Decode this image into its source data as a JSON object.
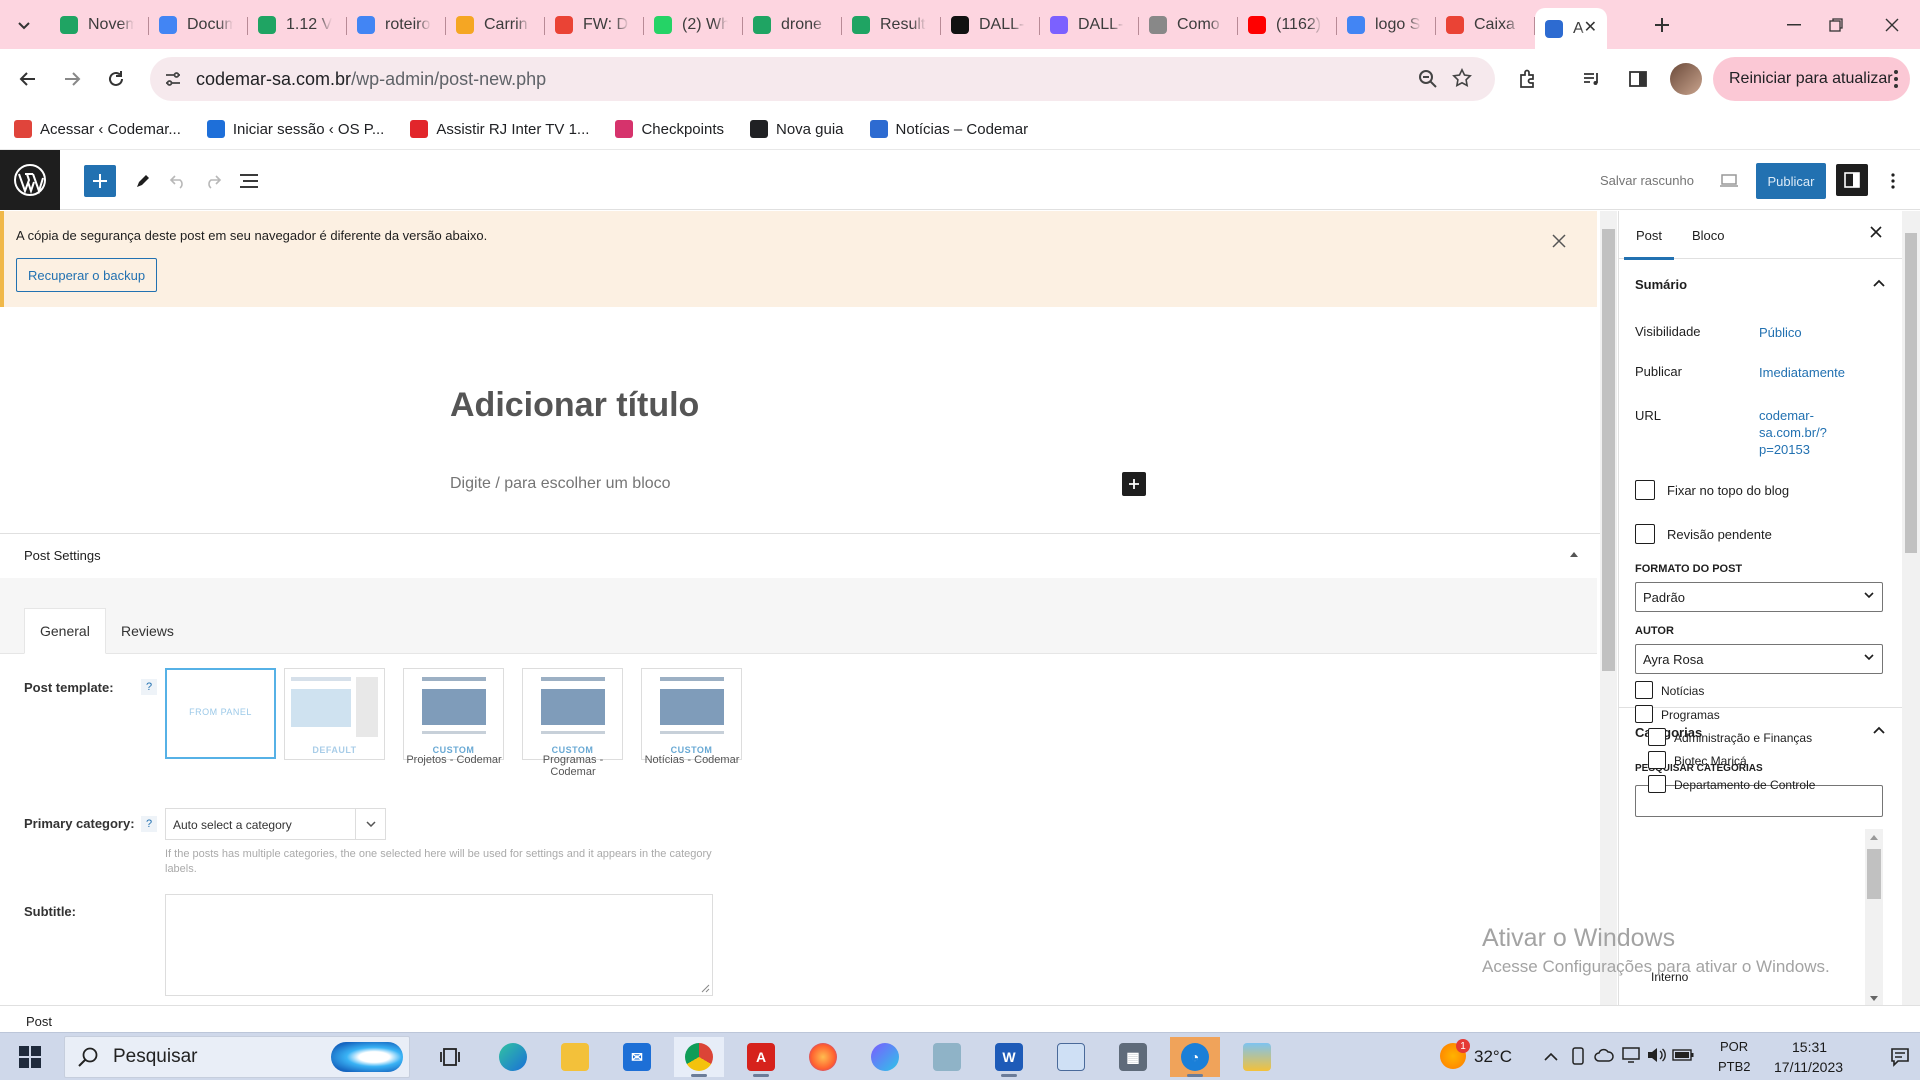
{
  "chrome": {
    "tabs": [
      {
        "title": "Novem",
        "icon": "google-drive-icon",
        "color": "#1fa463"
      },
      {
        "title": "Docum",
        "icon": "google-docs-icon",
        "color": "#4285f4"
      },
      {
        "title": "1.12 V",
        "icon": "google-drive-icon",
        "color": "#1fa463"
      },
      {
        "title": "roteiro",
        "icon": "google-docs-icon",
        "color": "#4285f4"
      },
      {
        "title": "Carrin",
        "icon": "shopping-icon",
        "color": "#f5a623"
      },
      {
        "title": "FW: D",
        "icon": "gmail-icon",
        "color": "#ea4335"
      },
      {
        "title": "(2) Wh",
        "icon": "whatsapp-icon",
        "color": "#25d366"
      },
      {
        "title": "drone",
        "icon": "google-drive-icon",
        "color": "#1fa463"
      },
      {
        "title": "Result",
        "icon": "google-drive-icon",
        "color": "#1fa463"
      },
      {
        "title": "DALL-E",
        "icon": "openai-icon",
        "color": "#111111"
      },
      {
        "title": "DALL-E",
        "icon": "dalle-icon",
        "color": "#7b61ff"
      },
      {
        "title": "Como",
        "icon": "book-icon",
        "color": "#888888"
      },
      {
        "title": "(1162)",
        "icon": "youtube-icon",
        "color": "#ff0000"
      },
      {
        "title": "logo S",
        "icon": "google-icon",
        "color": "#4285f4"
      },
      {
        "title": "Caixa",
        "icon": "gmail-icon",
        "color": "#ea4335"
      },
      {
        "title": "A",
        "icon": "codemar-icon",
        "color": "#2d6bd1",
        "active": true
      }
    ],
    "url_host": "codemar-sa.com.br",
    "url_path": "/wp-admin/post-new.php",
    "update_button": "Reiniciar para atualizar",
    "bookmarks": [
      {
        "label": "Acessar ‹ Codemar...",
        "icon": "codemar-icon",
        "color": "#e0443b"
      },
      {
        "label": "Iniciar sessão ‹ OS P...",
        "icon": "x-logo-icon",
        "color": "#1e6fd9"
      },
      {
        "label": "Assistir RJ Inter TV 1...",
        "icon": "globoplay-icon",
        "color": "#e2262b"
      },
      {
        "label": "Checkpoints",
        "icon": "checkpoints-icon",
        "color": "#d6336c"
      },
      {
        "label": "Nova guia",
        "icon": "globe-icon",
        "color": "#202124"
      },
      {
        "label": "Notícias – Codemar",
        "icon": "codemar-icon",
        "color": "#2d6bd1"
      }
    ]
  },
  "wp": {
    "save_draft": "Salvar rascunho",
    "publish": "Publicar",
    "notice": {
      "message": "A cópia de segurança deste post em seu navegador é diferente da versão abaixo.",
      "button": "Recuperar o backup"
    },
    "title_placeholder": "Adicionar título",
    "block_placeholder": "Digite / para escolher um bloco",
    "post_settings": {
      "heading": "Post Settings",
      "tabs": [
        "General",
        "Reviews"
      ],
      "template_label": "Post template:",
      "templates": [
        {
          "badge": "FROM PANEL",
          "caption": ""
        },
        {
          "badge": "DEFAULT",
          "caption": ""
        },
        {
          "badge": "CUSTOM",
          "caption": "Projetos - Codemar"
        },
        {
          "badge": "CUSTOM",
          "caption": "Programas - Codemar"
        },
        {
          "badge": "CUSTOM",
          "caption": "Notícias - Codemar"
        }
      ],
      "primary_category_label": "Primary category:",
      "primary_category_value": "Auto select a category",
      "primary_category_help": "If the posts has multiple categories, the one selected here will be used for settings and it appears in the category labels.",
      "subtitle_label": "Subtitle:",
      "help_mark": "?"
    },
    "footer": "Post"
  },
  "sidebar": {
    "tabs": [
      "Post",
      "Bloco"
    ],
    "summary_heading": "Sumário",
    "visibility_label": "Visibilidade",
    "visibility_value": "Público",
    "publish_label": "Publicar",
    "publish_value": "Imediatamente",
    "url_label": "URL",
    "url_value_1": "codemar-",
    "url_value_2": "sa.com.br/?",
    "url_value_3": "p=20153",
    "stick_top": "Fixar no topo do blog",
    "pending_review": "Revisão pendente",
    "format_label": "FORMATO DO POST",
    "format_value": "Padrão",
    "author_label": "AUTOR",
    "author_value": "Ayra Rosa",
    "categories_heading": "Categorias",
    "search_categories": "PESQUISAR CATEGORIAS",
    "categories": [
      {
        "label": "Notícias",
        "level": 0
      },
      {
        "label": "Programas",
        "level": 0
      },
      {
        "label": "Administração e Finanças",
        "level": 1
      },
      {
        "label": "Biotec Maricá",
        "level": 1
      },
      {
        "label": "Departamento de Controle",
        "level": 1
      }
    ],
    "category_wrap": "Interno"
  },
  "watermark": {
    "line1": "Ativar o Windows",
    "line2": "Acesse Configurações para ativar o Windows."
  },
  "taskbar": {
    "search": "Pesquisar",
    "weather": "32°C",
    "lang1": "POR",
    "lang2": "PTB2",
    "time": "15:31",
    "date": "17/11/2023",
    "notif_count": "1"
  }
}
